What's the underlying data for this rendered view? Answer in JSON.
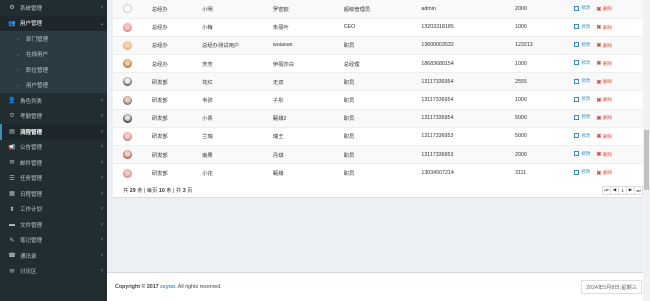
{
  "sidebar": {
    "items": [
      {
        "icon": "gear-icon",
        "label": "系统管理",
        "chevron": "‹"
      },
      {
        "icon": "users-icon",
        "label": "用户管理",
        "chevron": "⌄"
      },
      {
        "icon": "circle-icon",
        "label": "部门管理"
      },
      {
        "icon": "circle-icon",
        "label": "在线用户"
      },
      {
        "icon": "circle-icon",
        "label": "职位管理"
      },
      {
        "icon": "circle-icon",
        "label": "用户管理"
      },
      {
        "icon": "user-icon",
        "label": "角色列表",
        "chevron": "‹"
      },
      {
        "icon": "clock-icon",
        "label": "考勤管理",
        "chevron": "‹"
      },
      {
        "icon": "process-icon",
        "label": "流程管理",
        "chevron": "‹"
      },
      {
        "icon": "bullhorn-icon",
        "label": "公告管理",
        "chevron": "‹"
      },
      {
        "icon": "envelope-icon",
        "label": "邮件管理",
        "chevron": "‹"
      },
      {
        "icon": "tasks-icon",
        "label": "任务管理",
        "chevron": "‹"
      },
      {
        "icon": "calendar-icon",
        "label": "日程管理",
        "chevron": "‹"
      },
      {
        "icon": "plan-icon",
        "label": "工作计划",
        "chevron": "‹"
      },
      {
        "icon": "folder-icon",
        "label": "文件管理",
        "chevron": "‹"
      },
      {
        "icon": "note-icon",
        "label": "笔记管理",
        "chevron": "‹"
      },
      {
        "icon": "phone-book-icon",
        "label": "通讯录",
        "chevron": "‹"
      },
      {
        "icon": "comments-icon",
        "label": "讨论区",
        "chevron": "‹"
      }
    ]
  },
  "table": {
    "rows": [
      {
        "avatar": "av-empty",
        "dept": "总经办",
        "username": "小明",
        "realname": "罗密欧",
        "position": "超级管理员",
        "phone": "admin",
        "salary": "2000"
      },
      {
        "avatar": "av-1",
        "dept": "总经办",
        "username": "小梅",
        "realname": "朱丽叶",
        "position": "CEO",
        "phone": "13203318185",
        "salary": "1000"
      },
      {
        "avatar": "av-2",
        "dept": "总经办",
        "username": "总经办测试用户",
        "realname": "wuianan",
        "position": "职员",
        "phone": "13600003532",
        "salary": "123213"
      },
      {
        "avatar": "av-3",
        "dept": "总经办",
        "username": "芳芳",
        "realname": "伊丽莎白",
        "position": "总经理",
        "phone": "18683688154",
        "salary": "1000"
      },
      {
        "avatar": "av-4",
        "dept": "研发部",
        "username": "花红",
        "realname": "无双",
        "position": "职员",
        "phone": "13117336954",
        "salary": "2555"
      },
      {
        "avatar": "av-5",
        "dept": "研发部",
        "username": "韦弥",
        "realname": "子彤",
        "position": "职员",
        "phone": "13117336954",
        "salary": "1000"
      },
      {
        "avatar": "av-6",
        "dept": "研发部",
        "username": "小青",
        "realname": "甄嬛2",
        "position": "职员",
        "phone": "13117336954",
        "salary": "5000"
      },
      {
        "avatar": "av-7",
        "dept": "研发部",
        "username": "兰瑞",
        "realname": "瑞王",
        "position": "职员",
        "phone": "13117336953",
        "salary": "5000"
      },
      {
        "avatar": "av-8",
        "dept": "研发部",
        "username": "南果",
        "realname": "丹琪",
        "position": "职员",
        "phone": "13117336953",
        "salary": "2000"
      },
      {
        "avatar": "av-1",
        "dept": "研发部",
        "username": "小花",
        "realname": "甄嬛",
        "position": "职员",
        "phone": "13034507214",
        "salary": "3111"
      }
    ],
    "edit_label": "修改",
    "delete_label": "删除"
  },
  "summary": {
    "prefix": "共",
    "total": "29",
    "mid1": "条 | 每页",
    "per_page": "10",
    "mid2": "条 | 共",
    "pages": "3",
    "suffix": "页"
  },
  "pager": {
    "first": "⏮",
    "prev": "◀",
    "current": "1",
    "next": "▶",
    "last": "⏭"
  },
  "footer": {
    "copyright_prefix": "Copyright © 2017",
    "brand": "zsyoo.",
    "copyright_suffix": "All rights reserved.",
    "date": "2024年5月8日,星期三"
  }
}
